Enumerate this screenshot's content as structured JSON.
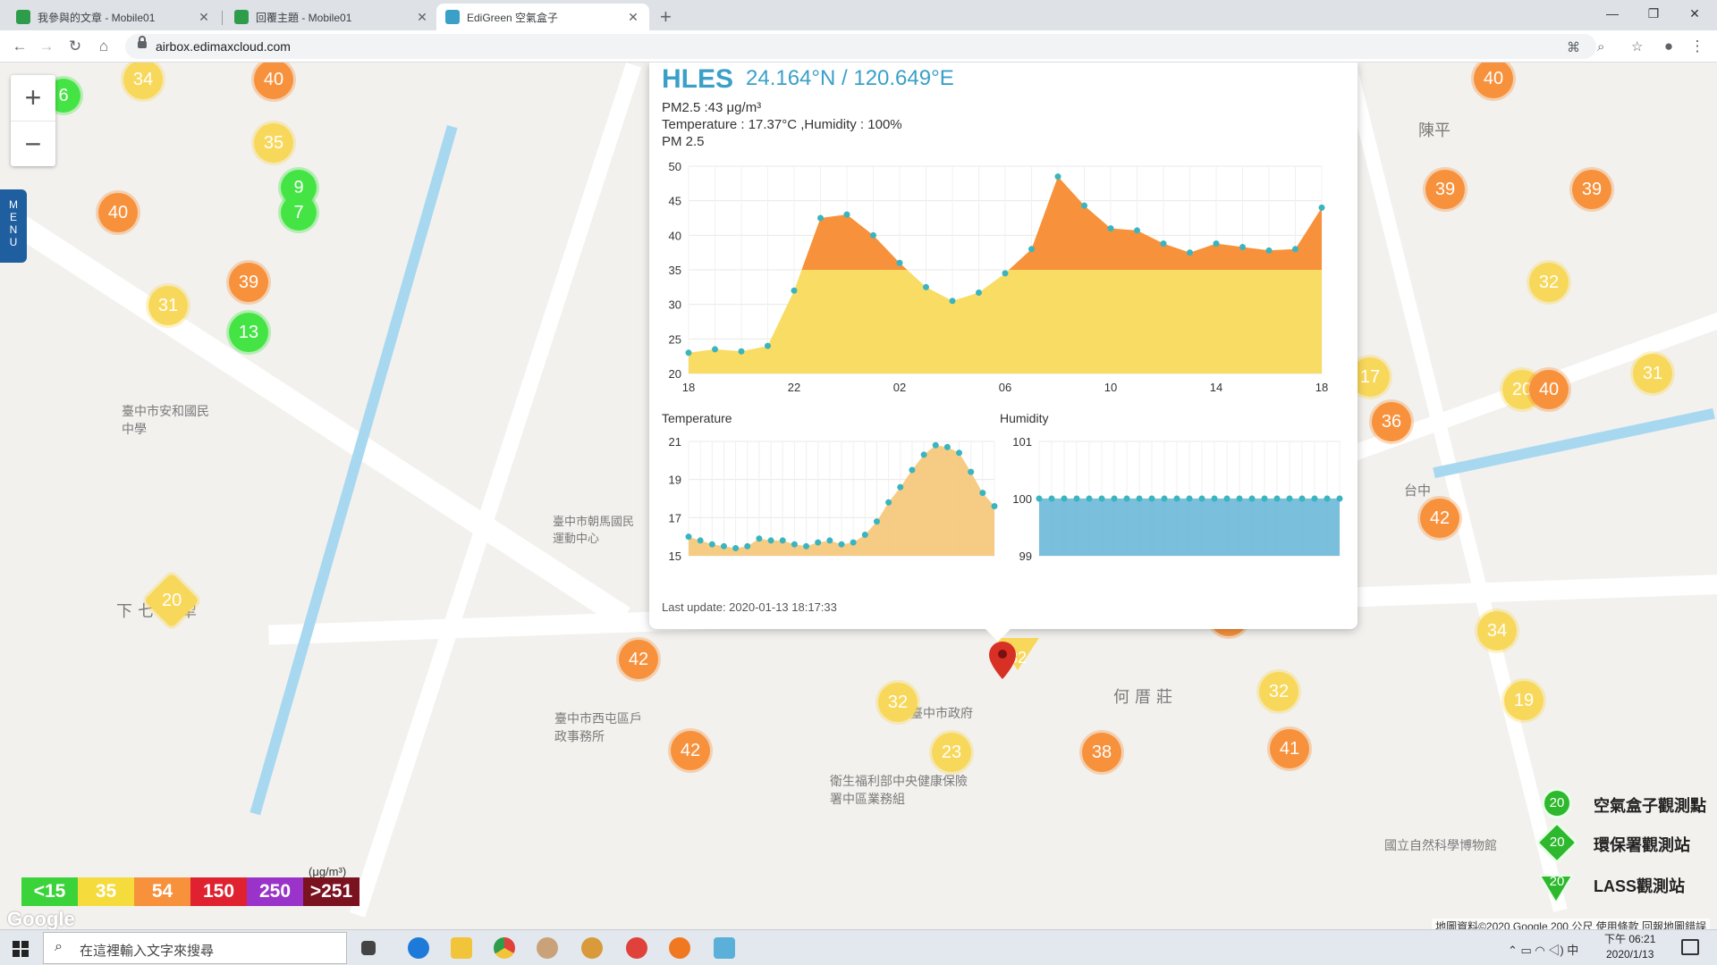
{
  "browser": {
    "tabs": [
      {
        "label": "我參與的文章 - Mobile01",
        "active": false
      },
      {
        "label": "回覆主題 - Mobile01",
        "active": false
      },
      {
        "label": "EdiGreen 空氣盒子",
        "active": true
      }
    ],
    "url": "airbox.edimaxcloud.com"
  },
  "map": {
    "place_labels": [
      "下七張犁",
      "何厝莊",
      "臺中市政府",
      "臺中市西屯區戶政事務所",
      "臺中市朝馬國民運動中心",
      "臺中市安和國民中學",
      "衛生福利部中央健康保險署中區業務組",
      "國立自然科學博物館",
      "陳平",
      "台中"
    ],
    "menu_label": "MENU",
    "attribution": "地圖資料©2020 Google   200 公尺   使用條款   回報地圖錯誤",
    "google_logo": "Google"
  },
  "popup": {
    "station": "HLES",
    "coords": "24.164°N / 120.649°E",
    "pm_line": "PM2.5 :43 μg/m³",
    "temp_hum_line": "Temperature : 17.37°C ,Humidity : 100%",
    "pm_title": "PM 2.5",
    "temp_title": "Temperature",
    "hum_title": "Humidity",
    "last_update": "Last update: 2020-01-13 18:17:33"
  },
  "chart_data": [
    {
      "type": "area",
      "title": "PM 2.5",
      "x_tick_labels": [
        "18",
        "22",
        "02",
        "06",
        "10",
        "14",
        "18"
      ],
      "ylim": [
        20,
        50
      ],
      "y_ticks": [
        20,
        25,
        30,
        35,
        40,
        45,
        50
      ],
      "threshold": 35,
      "colors": {
        "below": "#f8dc64",
        "above": "#f7913c",
        "point": "#3ab5c0"
      },
      "values": [
        23,
        23.5,
        23.2,
        24,
        32,
        42.5,
        43,
        40,
        36,
        32.5,
        30.5,
        31.7,
        34.5,
        38,
        48.5,
        44.3,
        41,
        40.7,
        38.8,
        37.5,
        38.8,
        38.3,
        37.8,
        38,
        44
      ]
    },
    {
      "type": "area",
      "title": "Temperature",
      "ylim": [
        15,
        21
      ],
      "y_ticks": [
        15,
        17,
        19,
        21
      ],
      "colors": {
        "fill": "#f5c778",
        "point": "#3ab5c0"
      },
      "values": [
        16.0,
        15.8,
        15.6,
        15.5,
        15.4,
        15.5,
        15.9,
        15.8,
        15.8,
        15.6,
        15.5,
        15.7,
        15.8,
        15.6,
        15.7,
        16.1,
        16.8,
        17.8,
        18.6,
        19.5,
        20.3,
        20.8,
        20.7,
        20.4,
        19.4,
        18.3,
        17.6
      ]
    },
    {
      "type": "area",
      "title": "Humidity",
      "ylim": [
        99,
        101
      ],
      "y_ticks": [
        99,
        100,
        101
      ],
      "colors": {
        "fill": "#6bb8d8",
        "point": "#3ab5c0"
      },
      "values": [
        100,
        100,
        100,
        100,
        100,
        100,
        100,
        100,
        100,
        100,
        100,
        100,
        100,
        100,
        100,
        100,
        100,
        100,
        100,
        100,
        100,
        100,
        100,
        100,
        100
      ]
    }
  ],
  "legend": {
    "unit": "(μg/m³)",
    "bins": [
      {
        "label": "<15",
        "color": "#3ad43a"
      },
      {
        "label": "35",
        "color": "#f5dc3c"
      },
      {
        "label": "54",
        "color": "#f7913c"
      },
      {
        "label": "150",
        "color": "#e0212f"
      },
      {
        "label": "250",
        "color": "#9a33c9"
      },
      {
        "label": ">251",
        "color": "#7a1220"
      }
    ]
  },
  "station_types": [
    {
      "label": "空氣盒子觀測點",
      "value": "20"
    },
    {
      "label": "環保署觀測站",
      "value": "20"
    },
    {
      "label": "LASS觀測站",
      "value": "20"
    }
  ],
  "taskbar": {
    "search_placeholder": "在這裡輸入文字來搜尋",
    "time": "下午 06:21",
    "date": "2020/1/13"
  }
}
